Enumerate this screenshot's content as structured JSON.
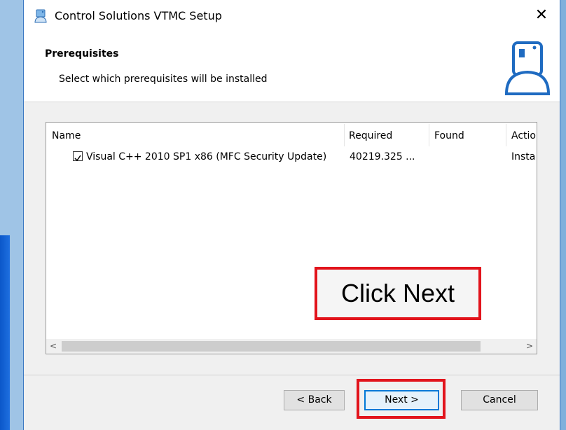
{
  "window": {
    "title": "Control Solutions VTMC Setup",
    "close_glyph": "✕"
  },
  "header": {
    "title": "Prerequisites",
    "subtitle": "Select which prerequisites will be installed"
  },
  "list": {
    "columns": [
      "Name",
      "Required",
      "Found",
      "Actio"
    ],
    "rows": [
      {
        "checked": true,
        "name": "Visual C++ 2010 SP1 x86 (MFC Security Update)",
        "required": "40219.325 ...",
        "found": "",
        "action": "Insta"
      }
    ]
  },
  "scrollbar": {
    "left_arrow": "<",
    "right_arrow": ">"
  },
  "callout": {
    "text": "Click Next"
  },
  "buttons": {
    "back": "< Back",
    "next": "Next >",
    "cancel": "Cancel"
  },
  "colors": {
    "highlight": "#e2141c",
    "focus": "#0078d7"
  },
  "icons": {
    "app": "installer-app-icon",
    "setup": "setup-drive-icon",
    "check": "checkmark-icon"
  }
}
